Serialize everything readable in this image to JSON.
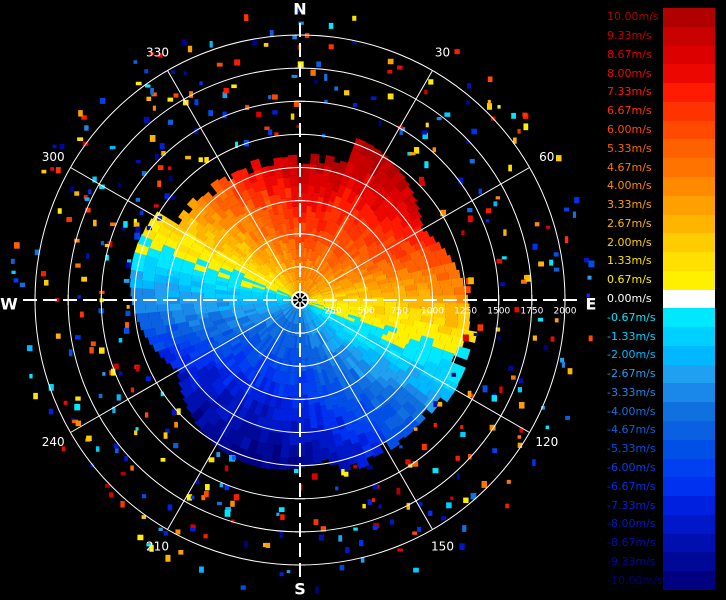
{
  "chart_data": {
    "type": "polar-radar",
    "compass": {
      "north": "N",
      "east": "E",
      "south": "S",
      "west": "W"
    },
    "bearing_labels": [
      "30",
      "60",
      "120",
      "150",
      "210",
      "240",
      "300",
      "330"
    ],
    "range_labels": [
      "250",
      "500",
      "750",
      "1000",
      "1250",
      "1500",
      "1750",
      "2000"
    ],
    "max_range": 2000,
    "legend": {
      "labels": [
        "10.00m/s",
        "9.33m/s",
        "8.67m/s",
        "8.00m/s",
        "7.33m/s",
        "6.67m/s",
        "6.00m/s",
        "5.33m/s",
        "4.67m/s",
        "4.00m/s",
        "3.33m/s",
        "2.67m/s",
        "2.00m/s",
        "1.33m/s",
        "0.67m/s",
        "0.00m/s",
        "-0.67m/s",
        "-1.33m/s",
        "-2.00m/s",
        "-2.67m/s",
        "-3.33m/s",
        "-4.00m/s",
        "-4.67m/s",
        "-5.33m/s",
        "-6.00m/s",
        "-6.67m/s",
        "-7.33m/s",
        "-8.00m/s",
        "-8.67m/s",
        "-9.33m/s",
        "-10.00m/s"
      ],
      "colors": [
        "#b00000",
        "#c80000",
        "#dc0000",
        "#ec0800",
        "#ff1a00",
        "#ff3300",
        "#ff4a00",
        "#ff6000",
        "#ff7400",
        "#ff8a00",
        "#ffa000",
        "#ffb400",
        "#ffcc00",
        "#ffe000",
        "#fff000",
        "#ffffff",
        "#00e8ff",
        "#00d0ff",
        "#00b8ff",
        "#20a0f0",
        "#1a88e8",
        "#1070e0",
        "#0a60e0",
        "#0050e8",
        "#0040f0",
        "#0030f0",
        "#0020e0",
        "#0018c8",
        "#0010b0",
        "#000898",
        "#000080"
      ]
    },
    "velocity_field": {
      "description": "velocity max ~10 m/s toward NE sector, min ~-10 m/s toward SW",
      "echo_max_range": 1300,
      "positive_bearing_center": 20,
      "negative_bearing_center": 200
    }
  }
}
